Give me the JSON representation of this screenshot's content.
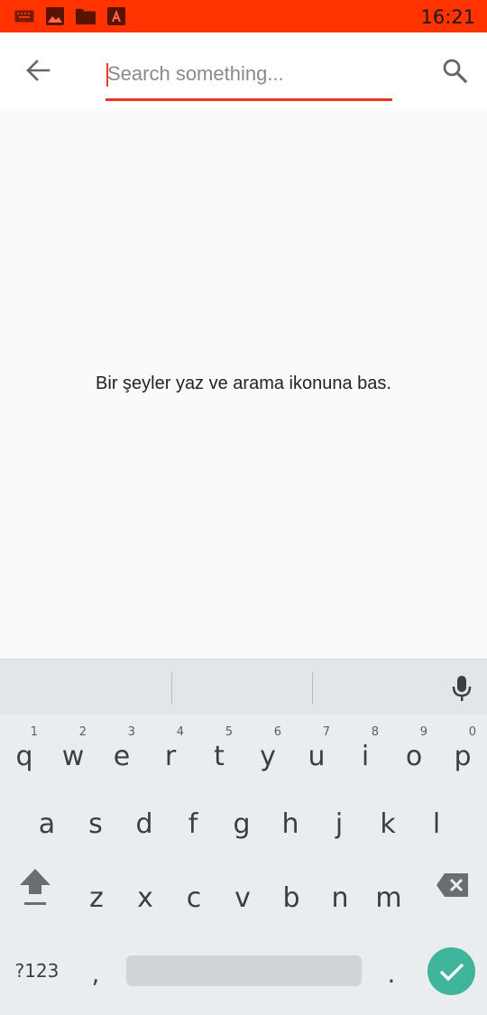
{
  "status_bar": {
    "time": "16:21",
    "color": "#ff3300",
    "icons": [
      "keyboard-icon",
      "image-icon",
      "folder-icon",
      "pdf-app-icon"
    ]
  },
  "search": {
    "placeholder": "Search something...",
    "value": "",
    "accent": "#e53a1f"
  },
  "content": {
    "empty_message": "Bir şeyler yaz ve arama ikonuna bas."
  },
  "keyboard": {
    "row1": [
      {
        "key": "q",
        "hint": "1"
      },
      {
        "key": "w",
        "hint": "2"
      },
      {
        "key": "e",
        "hint": "3"
      },
      {
        "key": "r",
        "hint": "4"
      },
      {
        "key": "t",
        "hint": "5"
      },
      {
        "key": "y",
        "hint": "6"
      },
      {
        "key": "u",
        "hint": "7"
      },
      {
        "key": "i",
        "hint": "8"
      },
      {
        "key": "o",
        "hint": "9"
      },
      {
        "key": "p",
        "hint": "0"
      }
    ],
    "row2": [
      "a",
      "s",
      "d",
      "f",
      "g",
      "h",
      "j",
      "k",
      "l"
    ],
    "row3": [
      "z",
      "x",
      "c",
      "v",
      "b",
      "n",
      "m"
    ],
    "symbols_label": "?123",
    "comma": ",",
    "period": ".",
    "enter_color": "#3fb59b"
  }
}
